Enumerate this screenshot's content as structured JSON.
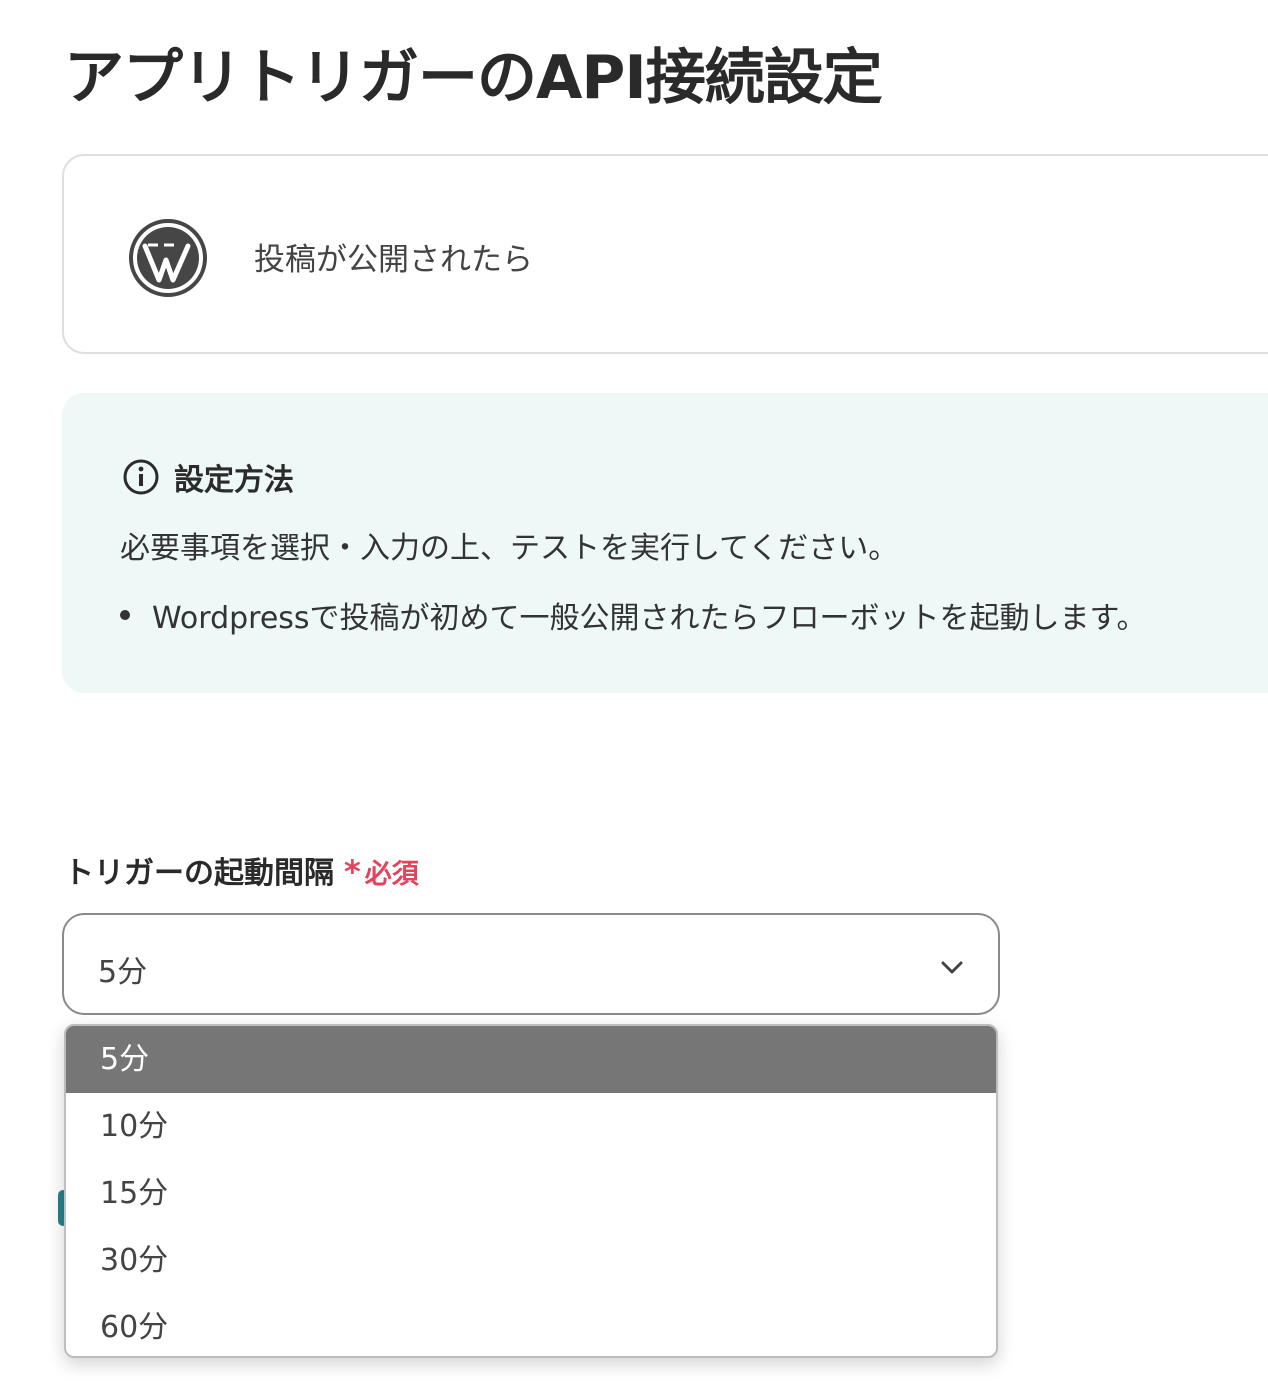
{
  "page": {
    "title": "アプリトリガーのAPI接続設定"
  },
  "trigger": {
    "app_icon": "wordpress-icon",
    "name": "投稿が公開されたら"
  },
  "info": {
    "icon": "info-circle-icon",
    "title": "設定方法",
    "text": "必要事項を選択・入力の上、テストを実行してください。",
    "bullets": [
      "Wordpressで投稿が初めて一般公開されたらフローボットを起動します。"
    ]
  },
  "interval_field": {
    "label": "トリガーの起動間隔",
    "required_mark": "*",
    "required_text": "必須",
    "value": "5分",
    "options": [
      "5分",
      "10分",
      "15分",
      "30分",
      "60分"
    ],
    "selected_index": 0
  },
  "colors": {
    "required": "#e2445c",
    "info_bg": "#eef8f7",
    "selected_option_bg": "#767676"
  }
}
